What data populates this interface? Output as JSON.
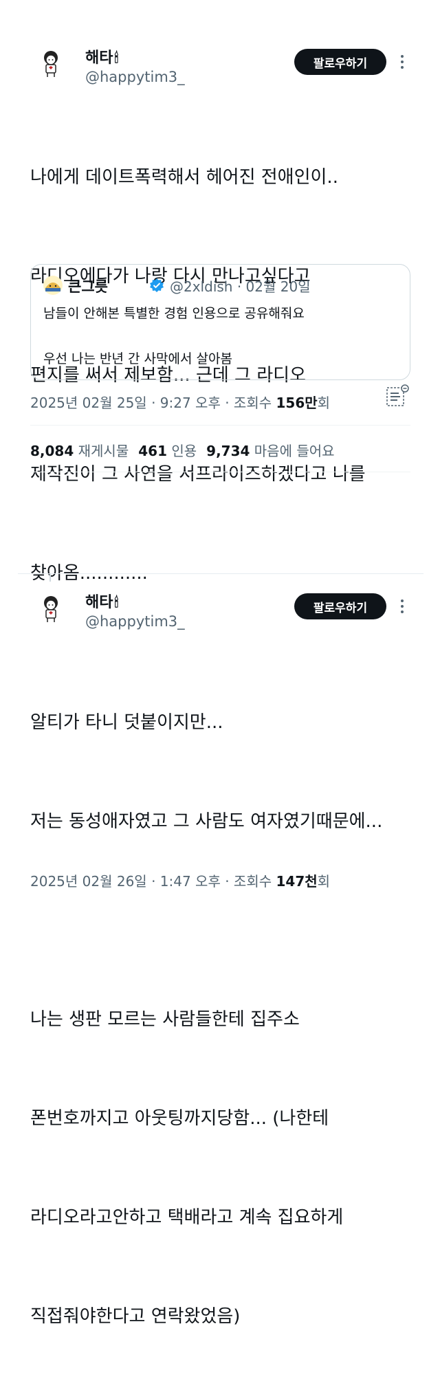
{
  "tweet1": {
    "name": "해타",
    "candle": "🕯",
    "handle": "@happytim3_",
    "follow_label": "팔로우하기",
    "lines": [
      "나에게 데이트폭력해서 헤어진 전애인이..",
      "라디오에다가 나랑 다시 만나고싶다고",
      "편지를 써서 제보함... 근데 그 라디오",
      "제작진이 그 사연을 서프라이즈하겠다고 나를",
      "찾아옴............"
    ],
    "quote": {
      "name": "큰그릇",
      "handle_date": "@2xldish · 02월 20일",
      "line1": "남들이 안해본 특별한 경험 인용으로 공유해줘요",
      "line2": "우선 나는 반년 간 사막에서 살아봄"
    },
    "meta_prefix": "2025년 02월 25일 · 9:27 오후 · 조회수 ",
    "views": "156만",
    "views_suffix": "회",
    "reposts_count": "8,084",
    "reposts_label": "재게시물",
    "quotes_count": "461",
    "quotes_label": "인용",
    "likes_count": "9,734",
    "likes_label": "마음에 들어요"
  },
  "tweet2": {
    "name": "해타",
    "candle": "🕯",
    "handle": "@happytim3_",
    "follow_label": "팔로우하기",
    "lines": [
      "알티가 타니 덧붙이지만...",
      "저는 동성애자였고 그 사람도 여자였기때문에...",
      "",
      "나는 생판 모르는 사람들한테 집주소",
      "폰번호까지고 아웃팅까지당함... (나한테",
      "라디오라고안하고 택배라고 계속 집요하게",
      "직접줘야한다고 연락왔었음)"
    ],
    "meta_prefix": "2025년 02월 26일 · 1:47 오후 · 조회수 ",
    "views": "147천",
    "views_suffix": "회"
  },
  "colors": {
    "text": "#0f1419",
    "secondary": "#536471",
    "verified": "#1d9bf0",
    "button": "#0f1419"
  }
}
